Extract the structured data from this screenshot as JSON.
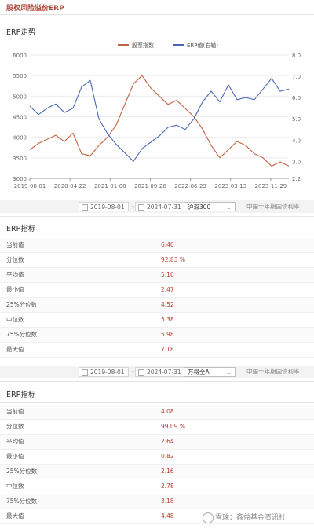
{
  "page": {
    "title": "股权风险溢价ERP"
  },
  "chart_card": {
    "title": "ERP走势"
  },
  "chart_data": {
    "type": "line",
    "title": "",
    "x_tick_labels": [
      "2019-08-01",
      "2020-04-22",
      "2021-01-08",
      "2021-09-28",
      "2022-06-23",
      "2023-03-13",
      "2023-11-29"
    ],
    "y_left_ticks": [
      "6000",
      "5500",
      "5000",
      "4500",
      "4000",
      "3500",
      "3000"
    ],
    "y_right_ticks": [
      "8.0",
      "7.0",
      "6.0",
      "5.0",
      "4.0",
      "3.0",
      "2.2"
    ],
    "ylim_left": [
      3000,
      6000
    ],
    "ylim_right": [
      2.2,
      8.0
    ],
    "legend_position": "top",
    "series": [
      {
        "name": "股票指数",
        "axis": "left",
        "color": "#c0623f",
        "x": [
          0,
          2,
          4,
          6,
          8,
          10,
          12,
          14,
          16,
          18,
          20,
          22,
          24,
          26,
          28,
          30,
          32,
          34,
          36,
          38,
          40,
          42,
          44,
          46,
          48,
          50,
          52,
          54,
          56,
          58,
          60
        ],
        "values": [
          3700,
          3850,
          3950,
          4050,
          3900,
          4100,
          3600,
          3550,
          3800,
          4000,
          4300,
          4800,
          5300,
          5500,
          5200,
          5000,
          4800,
          4900,
          4700,
          4500,
          4200,
          3800,
          3500,
          3700,
          3900,
          3800,
          3600,
          3500,
          3300,
          3400,
          3300
        ]
      },
      {
        "name": "ERP值(右轴)",
        "axis": "right",
        "color": "#4a67b5",
        "x": [
          0,
          2,
          4,
          6,
          8,
          10,
          12,
          14,
          16,
          18,
          20,
          22,
          24,
          26,
          28,
          30,
          32,
          34,
          36,
          38,
          40,
          42,
          44,
          46,
          48,
          50,
          52,
          54,
          56,
          58,
          60
        ],
        "values": [
          5.6,
          5.2,
          5.5,
          5.7,
          5.3,
          5.5,
          6.5,
          6.8,
          5.0,
          4.3,
          3.8,
          3.4,
          3.0,
          3.6,
          3.9,
          4.2,
          4.6,
          4.7,
          4.5,
          5.0,
          5.8,
          6.3,
          5.8,
          6.6,
          5.9,
          6.0,
          5.9,
          6.4,
          6.9,
          6.3,
          6.4
        ]
      }
    ]
  },
  "filter1": {
    "start_date": "2019-08-01",
    "end_date": "2024-07-31",
    "index": "沪深300",
    "benchmark": "中国十年期国债利率"
  },
  "table1": {
    "title": "ERP指标",
    "rows": [
      {
        "name": "当前值",
        "value": "6.40"
      },
      {
        "name": "分位数",
        "value": "92.83 %"
      },
      {
        "name": "平均值",
        "value": "5.16"
      },
      {
        "name": "最小值",
        "value": "2.47"
      },
      {
        "name": "25%分位数",
        "value": "4.52"
      },
      {
        "name": "中位数",
        "value": "5.38"
      },
      {
        "name": "75%分位数",
        "value": "5.98"
      },
      {
        "name": "最大值",
        "value": "7.18"
      }
    ]
  },
  "filter2": {
    "start_date": "2019-08-01",
    "end_date": "2024-07-31",
    "index": "万得全A",
    "benchmark": "中国十年期国债利率"
  },
  "table2": {
    "title": "ERP指标",
    "rows": [
      {
        "name": "当前值",
        "value": "4.08"
      },
      {
        "name": "分位数",
        "value": "99.09 %"
      },
      {
        "name": "平均值",
        "value": "2.64"
      },
      {
        "name": "最小值",
        "value": "0.82"
      },
      {
        "name": "25%分位数",
        "value": "2.16"
      },
      {
        "name": "中位数",
        "value": "2.78"
      },
      {
        "name": "75%分位数",
        "value": "3.18"
      },
      {
        "name": "最大值",
        "value": "4.48"
      }
    ]
  },
  "watermark": {
    "text": "雪球：鑫益基金资讯社"
  }
}
